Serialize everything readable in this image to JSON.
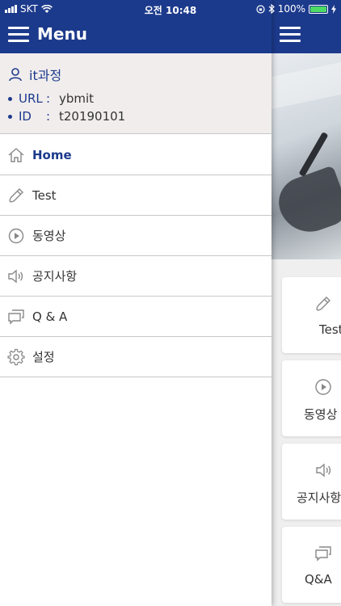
{
  "status_bar": {
    "carrier": "SKT",
    "time": "오전 10:48",
    "battery": "100%",
    "battery_level": 1.0
  },
  "drawer": {
    "title": "Menu",
    "profile": {
      "course": "it과정",
      "url_key": "URL",
      "url_sep": ":",
      "url_value": "ybmit",
      "id_key": "ID",
      "id_sep": ":",
      "id_value": "t20190101"
    },
    "items": [
      {
        "label": "Home",
        "icon": "home-icon",
        "active": true
      },
      {
        "label": "Test",
        "icon": "pencil-icon",
        "active": false
      },
      {
        "label": "동영상",
        "icon": "play-icon",
        "active": false
      },
      {
        "label": "공지사항",
        "icon": "speaker-icon",
        "active": false
      },
      {
        "label": "Q & A",
        "icon": "chat-icon",
        "active": false
      },
      {
        "label": "설정",
        "icon": "gear-icon",
        "active": false
      }
    ]
  },
  "main": {
    "cards": [
      {
        "label": "Test",
        "icon": "pencil-icon"
      },
      {
        "label": "동영상",
        "icon": "play-icon"
      },
      {
        "label": "공지사항",
        "icon": "speaker-icon"
      },
      {
        "label": "Q&A",
        "icon": "chat-icon"
      }
    ]
  },
  "colors": {
    "brand": "#1c3a8c",
    "profile_bg": "#f1eded",
    "battery_green": "#4cd964"
  }
}
